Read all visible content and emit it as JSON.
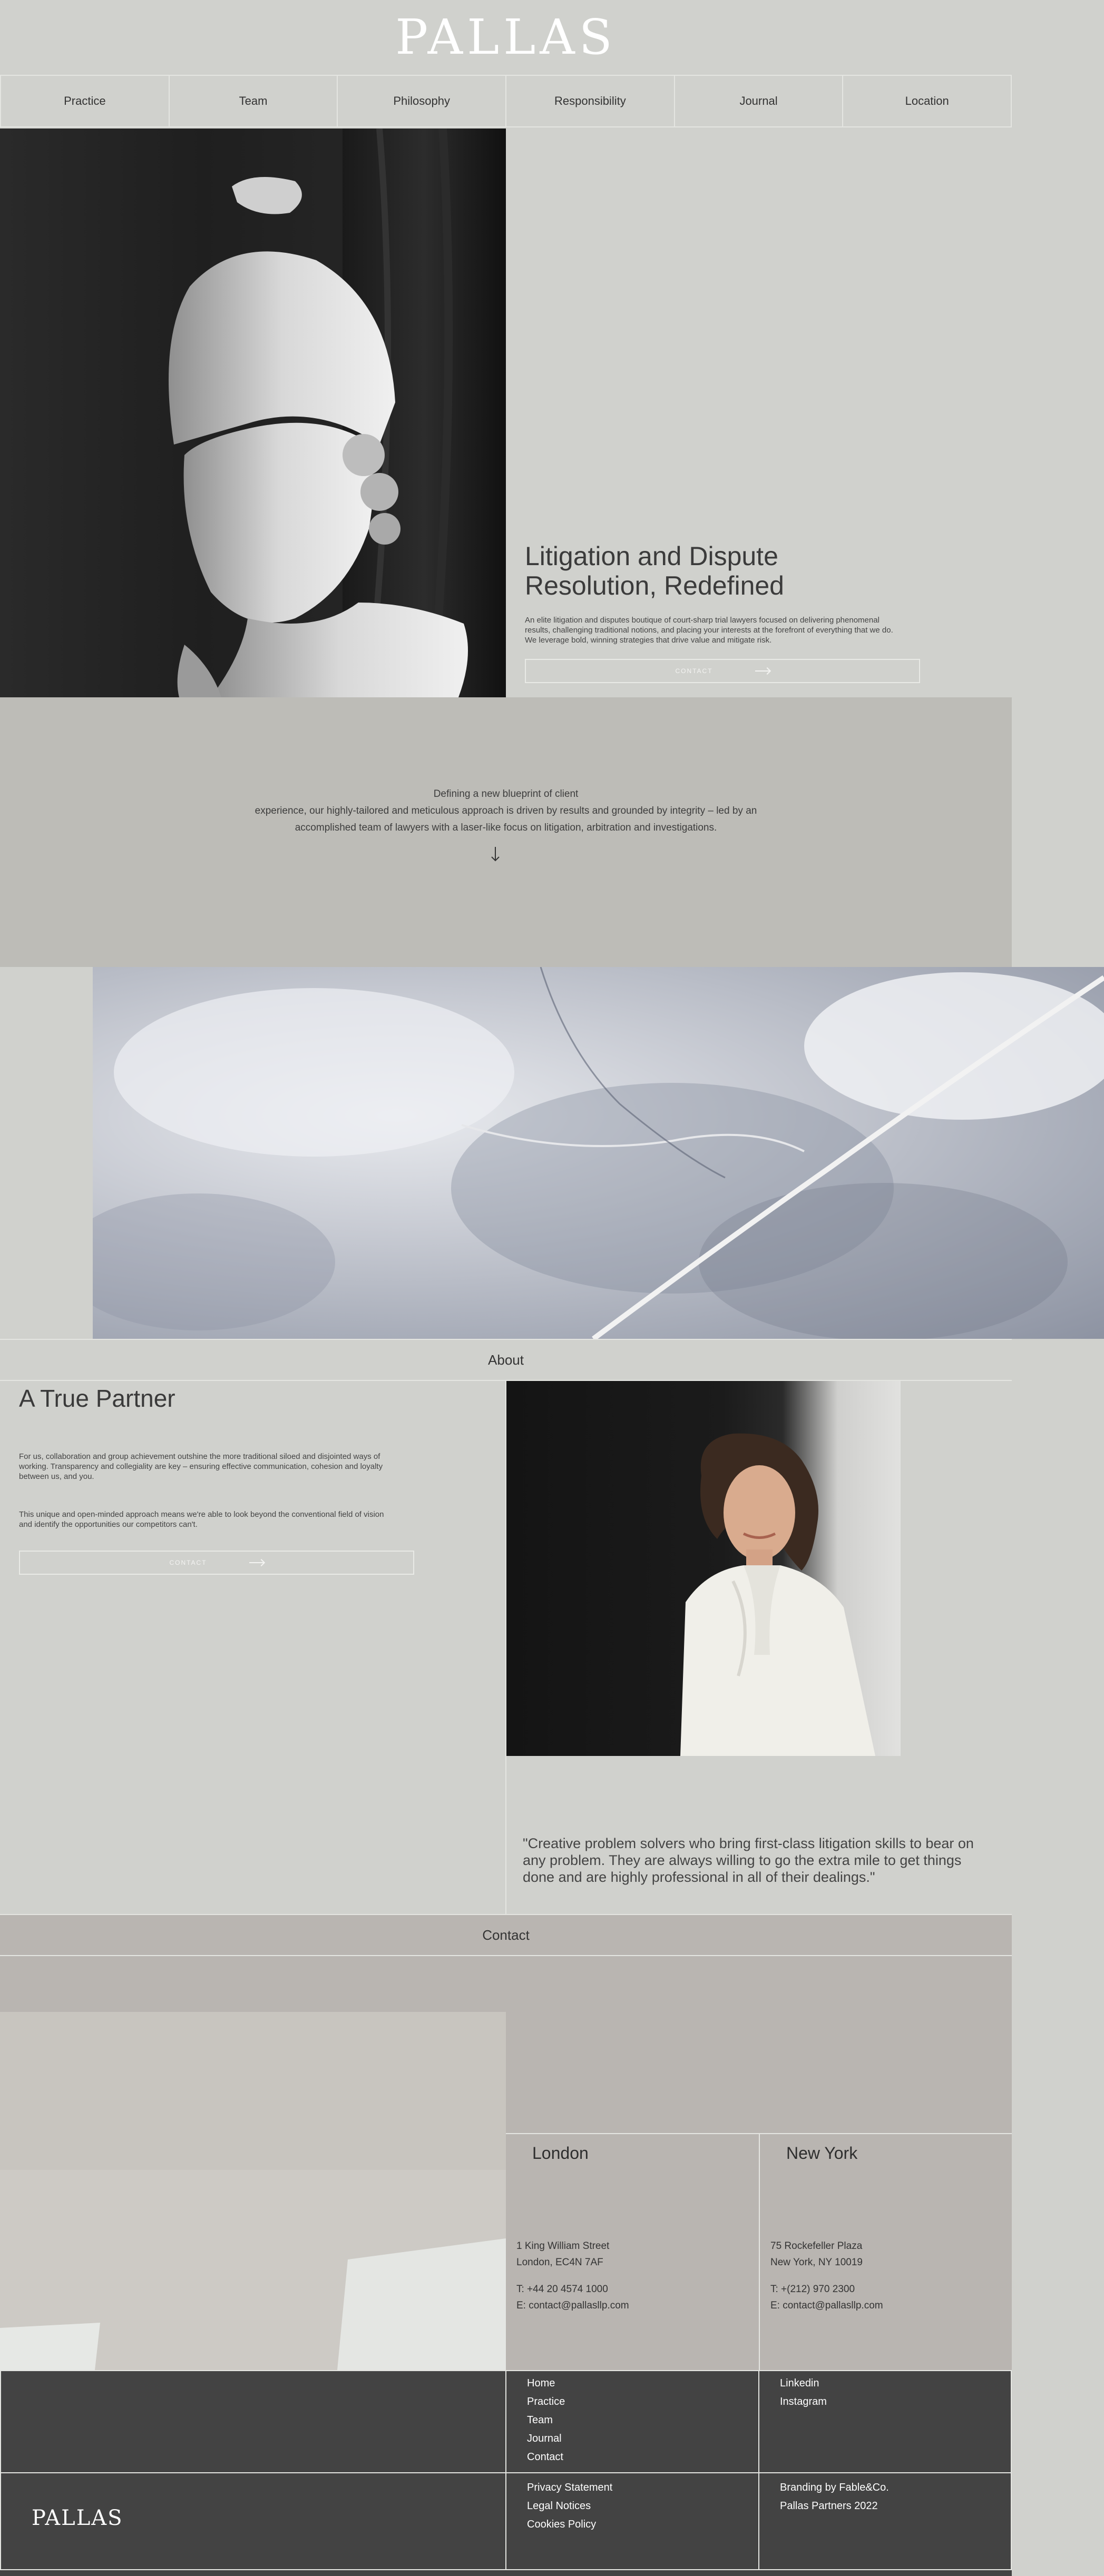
{
  "brand": {
    "logo": "PALLAS"
  },
  "nav": {
    "items": [
      {
        "label": "Practice"
      },
      {
        "label": "Team"
      },
      {
        "label": "Philosophy"
      },
      {
        "label": "Responsibility"
      },
      {
        "label": "Journal"
      },
      {
        "label": "Location"
      }
    ]
  },
  "hero": {
    "title_line1": "Litigation and Dispute",
    "title_line2": "Resolution, Redefined",
    "description": "An elite litigation and disputes boutique of court-sharp trial lawyers focused on delivering phenomenal results, challenging traditional notions, and placing your interests at the forefront of everything that we do. We leverage bold, winning strategies that drive value and mitigate risk.",
    "cta_label": "CONTACT"
  },
  "intro": {
    "line1": "Defining a new blueprint of client",
    "line2": "experience, our highly-tailored and meticulous approach is driven by results and grounded by integrity – led by an",
    "line3": "accomplished team of lawyers with a laser-like focus on litigation, arbitration and investigations."
  },
  "about": {
    "section_label": "About",
    "title": "A True Partner",
    "paragraph1": "For us, collaboration and group achievement outshine the more traditional siloed and disjointed ways of working. Transparency and collegiality are key – ensuring effective communication, cohesion and loyalty between us, and you.",
    "paragraph2": "This unique and open-minded approach means we're able to look beyond the conventional field of vision and identify the opportunities our competitors can't.",
    "cta_label": "CONTACT",
    "quote": "\"Creative problem solvers who bring first-class litigation skills to bear on any problem. They are always willing to go the extra mile to get things done and are highly professional in all of their dealings.\""
  },
  "contact": {
    "section_label": "Contact",
    "offices": [
      {
        "name": "London",
        "address1": "1 King William Street",
        "address2": "London, EC4N 7AF",
        "phone": "T: +44 20 4574 1000",
        "email": "E: contact@pallasllp.com"
      },
      {
        "name": "New York",
        "address1": "75 Rockefeller Plaza",
        "address2": "New York, NY 10019",
        "phone": "T: +(212) 970 2300",
        "email": "E: contact@pallasllp.com"
      }
    ]
  },
  "footer": {
    "nav_links": [
      "Home",
      "Practice",
      "Team",
      "Journal",
      "Contact"
    ],
    "social_links": [
      "Linkedin",
      "Instagram"
    ],
    "legal_links": [
      "Privacy Statement",
      "Legal Notices",
      "Cookies Policy"
    ],
    "credits": [
      "Branding by Fable&Co.",
      "Pallas Partners 2022"
    ],
    "logo": "PALLAS"
  },
  "colors": {
    "page_bg": "#d0d1cd",
    "band_bg": "#bdbcb7",
    "contact_bg": "#b9b5b1",
    "footer_bg": "#434343",
    "rule": "#e4e5e1"
  }
}
